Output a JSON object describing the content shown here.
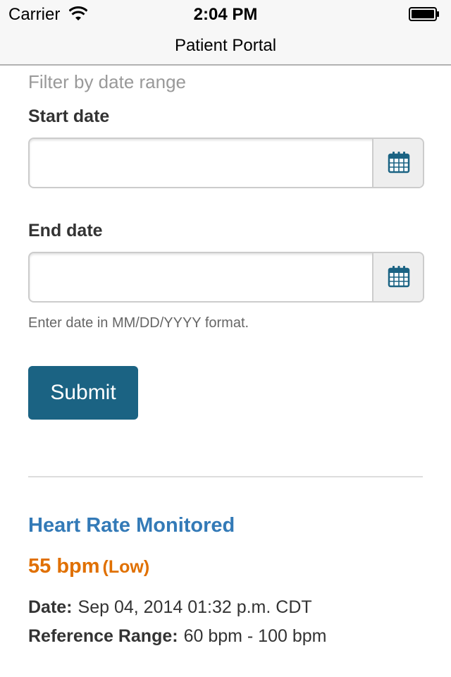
{
  "status_bar": {
    "carrier": "Carrier",
    "time": "2:04 PM"
  },
  "nav": {
    "title": "Patient Portal"
  },
  "filter": {
    "heading": "Filter by date range",
    "start_label": "Start date",
    "start_value": "",
    "end_label": "End date",
    "end_value": "",
    "help": "Enter date in MM/DD/YYYY format.",
    "submit_label": "Submit"
  },
  "result": {
    "title": "Heart Rate Monitored",
    "value": "55 bpm",
    "flag": "(Low)",
    "date_label": "Date:",
    "date_value": "Sep 04, 2014 01:32 p.m. CDT",
    "range_label": "Reference Range:",
    "range_value": "60 bpm - 100 bpm"
  },
  "colors": {
    "primary_button": "#1b6383",
    "title_blue": "#337ab7",
    "value_orange": "#e07000",
    "calendar_icon": "#1b6383"
  },
  "icons": [
    "wifi-icon",
    "battery-icon",
    "calendar-icon"
  ]
}
